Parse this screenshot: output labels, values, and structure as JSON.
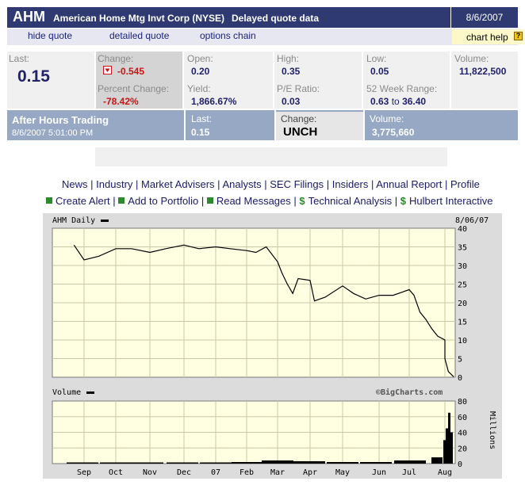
{
  "header": {
    "symbol": "AHM",
    "company": "American Home Mtg Invt Corp (NYSE)",
    "delay_label": "Delayed quote data",
    "date": "8/6/2007"
  },
  "links": {
    "hide_quote": "hide quote",
    "detailed_quote": "detailed quote",
    "options_chain": "options chain",
    "chart_help": "chart help",
    "help_icon": "?"
  },
  "quote": {
    "last_label": "Last:",
    "last": "0.15",
    "change_label": "Change:",
    "change": "-0.545",
    "pct_change_label": "Percent Change:",
    "pct_change": "-78.42%",
    "open_label": "Open:",
    "open": "0.20",
    "yield_label": "Yield:",
    "yield": "1,866.67%",
    "high_label": "High:",
    "high": "0.35",
    "pe_label": "P/E Ratio:",
    "pe": "0.03",
    "low_label": "Low:",
    "low": "0.05",
    "range_label": "52 Week Range:",
    "range_low": "0.63",
    "range_to": "to",
    "range_high": "36.40",
    "volume_label": "Volume:",
    "volume": "11,822,500"
  },
  "after_hours": {
    "title": "After Hours Trading",
    "timestamp": "8/6/2007 5:01:00 PM",
    "last_label": "Last:",
    "last": "0.15",
    "change_label": "Change:",
    "change": "UNCH",
    "volume_label": "Volume:",
    "volume": "3,775,660"
  },
  "nav_row1": [
    "News",
    "Industry",
    "Market Advisers",
    "Analysts",
    "SEC Filings",
    "Insiders",
    "Annual Report",
    "Profile"
  ],
  "nav_row2": [
    "Create Alert",
    "Add to Portfolio",
    "Read Messages",
    "Technical Analysis",
    "Hulbert Interactive"
  ],
  "nav_separator": "|",
  "chart_data": [
    {
      "type": "line",
      "title": "AHM Daily",
      "date_label": "8/06/07",
      "x_ticks": [
        "Sep",
        "Oct",
        "Nov",
        "Dec",
        "07",
        "Feb",
        "Mar",
        "Apr",
        "May",
        "Jun",
        "Jul",
        "Aug"
      ],
      "y_ticks": [
        "0",
        "5",
        "10",
        "15",
        "20",
        "25",
        "30",
        "35",
        "40"
      ],
      "ylim": [
        0,
        40
      ],
      "grid": true,
      "x": [
        "Aug 21",
        "Sep 1",
        "Sep 15",
        "Oct 1",
        "Oct 15",
        "Nov 1",
        "Nov 15",
        "Dec 1",
        "Dec 15",
        "Jan 1",
        "Jan 15",
        "Feb 1",
        "Feb 10",
        "Feb 20",
        "Mar 1",
        "Mar 5",
        "Mar 10",
        "Mar 15",
        "Mar 20",
        "Apr 1",
        "Apr 5",
        "Apr 15",
        "May 1",
        "May 10",
        "May 20",
        "Jun 1",
        "Jun 15",
        "Jul 1",
        "Jul 5",
        "Jul 10",
        "Jul 15",
        "Jul 20",
        "Jul 25",
        "Jul 31",
        "Aug 1",
        "Aug 3",
        "Aug 6"
      ],
      "series": [
        {
          "values": [
            35.5,
            31.5,
            32.5,
            34.5,
            34.5,
            33.5,
            34.5,
            35.5,
            34.5,
            35.0,
            34.5,
            34.0,
            33.5,
            35.0,
            31.0,
            28.0,
            25.0,
            22.5,
            26.5,
            26.0,
            20.5,
            21.5,
            24.5,
            22.5,
            21.0,
            22.0,
            22.0,
            23.5,
            22.0,
            17.5,
            15.5,
            13.0,
            11.0,
            10.0,
            5.0,
            1.5,
            0.15
          ]
        }
      ]
    },
    {
      "type": "bar",
      "title": "Volume",
      "unit": "Millions",
      "credit": "©BigCharts.com",
      "y_ticks": [
        "0",
        "20",
        "40",
        "60",
        "80"
      ],
      "ylim": [
        0,
        80
      ],
      "grid": true,
      "x": [
        "Sep",
        "Oct",
        "Nov",
        "Dec",
        "Jan",
        "Feb",
        "Mar",
        "Apr",
        "May",
        "Jun",
        "Jul",
        "Early Aug",
        "Aug 1",
        "Aug 2",
        "Aug 3",
        "Aug 6"
      ],
      "values": [
        1.5,
        1.5,
        1.5,
        1.5,
        1.5,
        2,
        4,
        3,
        2,
        2,
        4,
        8,
        30,
        45,
        65,
        40
      ]
    }
  ]
}
